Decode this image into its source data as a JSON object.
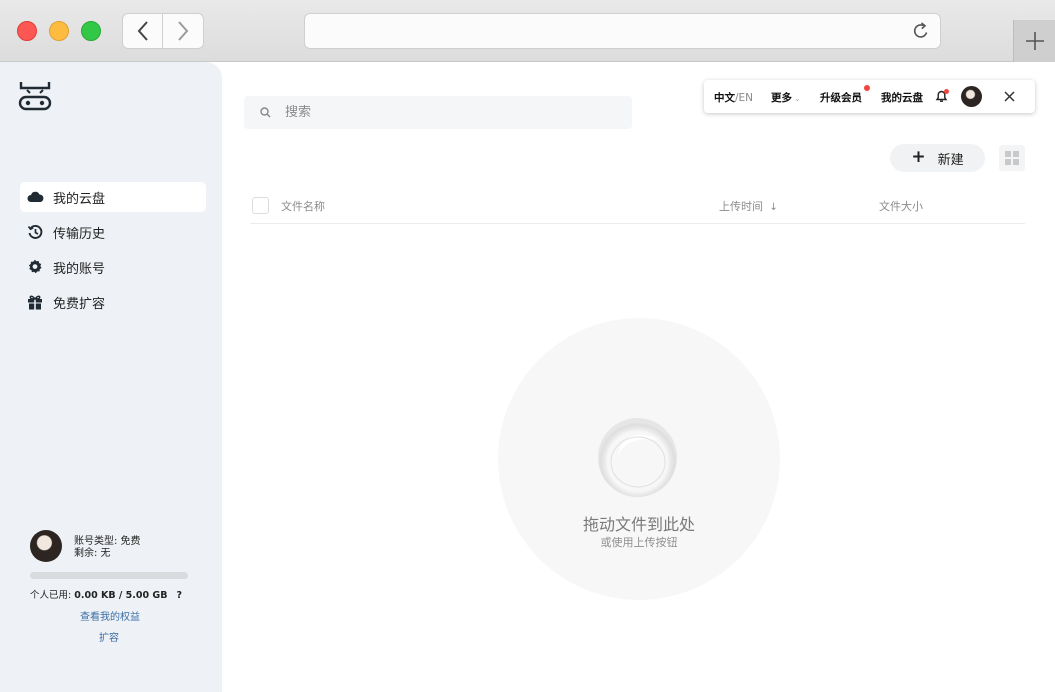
{
  "browser": {
    "back_icon": "chevron-left",
    "forward_icon": "chevron-right",
    "reload_icon": "reload",
    "new_tab_icon": "plus"
  },
  "sidebar": {
    "logo_icon": "robot-logo",
    "items": [
      {
        "label": "我的云盘",
        "icon": "cloud-icon",
        "active": true
      },
      {
        "label": "传输历史",
        "icon": "history-icon",
        "active": false
      },
      {
        "label": "我的账号",
        "icon": "gear-icon",
        "active": false
      },
      {
        "label": "免费扩容",
        "icon": "gift-icon",
        "active": false
      }
    ],
    "user": {
      "account_type_label": "账号类型: 免费",
      "remaining_label": "剩余: 无",
      "usage_prefix": "个人已用:",
      "usage_value": "0.00 KB / 5.00 GB",
      "usage_fraction": 0,
      "help": "?",
      "view_rights": "查看我的权益",
      "expand": "扩容"
    }
  },
  "search": {
    "placeholder": "搜索"
  },
  "topbar": {
    "lang_zh": "中文",
    "lang_sep": "/",
    "lang_en": "EN",
    "more": "更多",
    "upgrade": "升级会员",
    "my_cloud": "我的云盘",
    "close_icon": "close"
  },
  "toolbar": {
    "new_label": "新建"
  },
  "table": {
    "columns": [
      "文件名称",
      "上传时间",
      "文件大小"
    ],
    "sort_indicator": "↓"
  },
  "empty": {
    "title": "拖动文件到此处",
    "subtitle": "或使用上传按钮"
  },
  "colors": {
    "accent": "#3a7afe",
    "notify": "#f2453d",
    "sidebar_bg": "#eef1f5"
  }
}
